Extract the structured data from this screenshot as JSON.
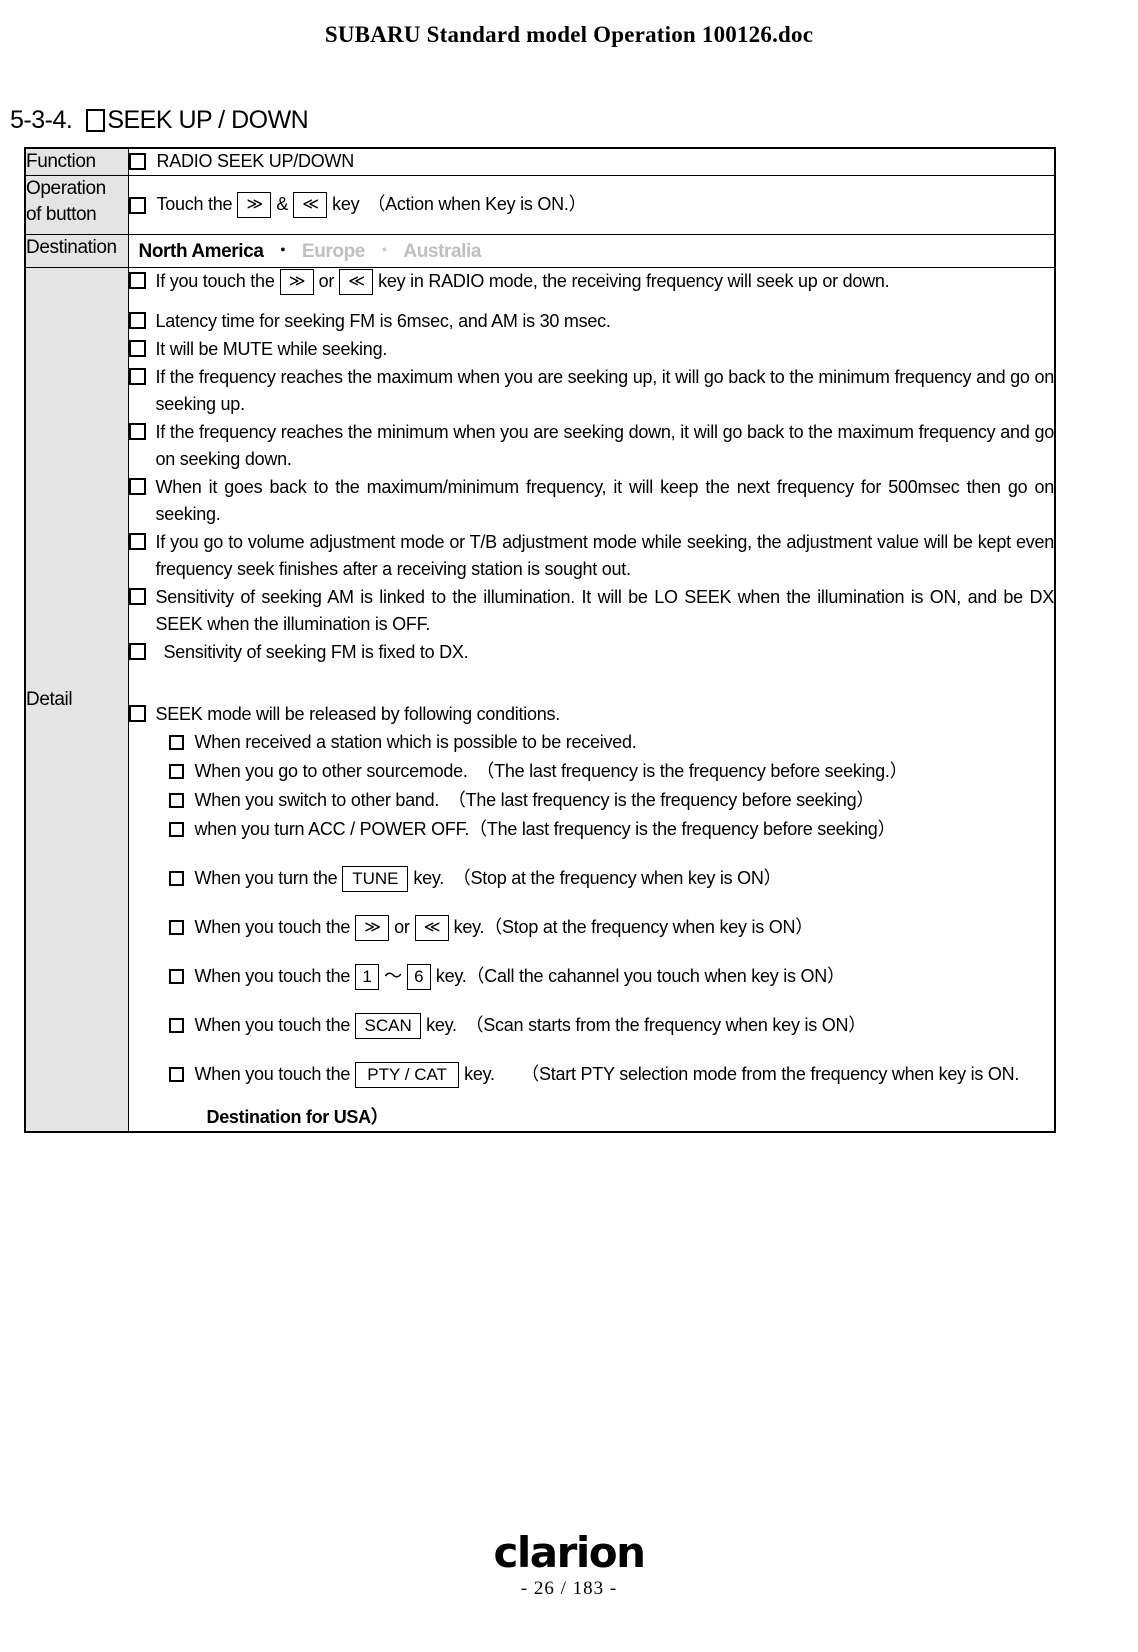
{
  "header": {
    "title": "SUBARU Standard model Operation 100126.doc"
  },
  "section": {
    "number": "5-3-4.",
    "title": "SEEK UP / DOWN"
  },
  "table": {
    "labels": {
      "function": "Function",
      "operation_line1": "Operation",
      "operation_line2": "of button",
      "destination": "Destination",
      "detail": "Detail"
    },
    "function_value": "RADIO SEEK UP/DOWN",
    "operation": {
      "prefix": "Touch the",
      "key_up": "≫",
      "conjunction": "&",
      "key_down": "≪",
      "suffix": "key",
      "note": "（Action when Key is ON.）"
    },
    "destination": {
      "options": [
        "North America",
        "Europe",
        "Australia"
      ],
      "selected": "North America",
      "separator": "・"
    }
  },
  "detail": {
    "items": [
      {
        "before": "If you touch the",
        "key_a": "≫",
        "middle": "or",
        "key_b": "≪",
        "after": "key in RADIO mode, the receiving frequency will seek up or down."
      },
      {
        "text": "Latency time for seeking FM is 6msec, and AM is 30 msec."
      },
      {
        "text": "It will be MUTE while seeking."
      },
      {
        "text": "If the frequency reaches the maximum when you are seeking up, it will go back to the minimum frequency and go on seeking up."
      },
      {
        "text": "If the frequency reaches the minimum when you are seeking down, it will go back to the maximum frequency and go on seeking down."
      },
      {
        "text": "When it goes back to the maximum/minimum frequency, it will keep the next frequency for 500msec then go on seeking."
      },
      {
        "text": "If you go to volume adjustment mode or T/B adjustment mode while seeking, the adjustment value will be kept even frequency seek finishes after a receiving station is sought out."
      },
      {
        "text": "Sensitivity of seeking AM is linked to the illumination. It will be LO SEEK when the illumination is ON, and be DX SEEK when the illumination is OFF."
      },
      {
        "text": "Sensitivity of seeking FM is fixed to DX."
      }
    ],
    "release_heading": "SEEK mode will be released by following conditions.",
    "release_conditions": [
      {
        "text": "When received a station which is possible to be received."
      },
      {
        "text": "When you go to other sourcemode.　（The last frequency is the frequency before seeking.）"
      },
      {
        "text": "When you switch to other band.　（The last frequency is the frequency before seeking）"
      },
      {
        "text": "when you turn ACC / POWER  OFF.（The last frequency is the frequency before seeking）"
      }
    ],
    "key_conditions": [
      {
        "before": "When you turn the",
        "keys": [
          "TUNE"
        ],
        "key_style": "wide",
        "after": "key.　（Stop at the frequency when key is ON）"
      },
      {
        "before": "When you touch the",
        "keys": [
          "≫",
          "≪"
        ],
        "joiner": "or",
        "key_style": "chev",
        "after": "key.（Stop at the frequency when key is ON）"
      },
      {
        "before": "When you touch the",
        "keys": [
          "1",
          "6"
        ],
        "joiner": "～",
        "key_style": "narrow",
        "after": "key.（Call the cahannel you touch when key is ON）"
      },
      {
        "before": "When you touch the",
        "keys": [
          "SCAN"
        ],
        "key_style": "wide",
        "after": "key.　（Scan starts from the frequency when key is ON）"
      },
      {
        "before": "When you touch the",
        "keys": [
          "PTY / CAT"
        ],
        "key_style": "xwide",
        "after": "key.　　（Start PTY selection mode from the frequency when key is ON."
      }
    ],
    "final_note": "Destination for USA）"
  },
  "footer": {
    "logo": "clarion",
    "page": "- 26 / 183 -"
  }
}
